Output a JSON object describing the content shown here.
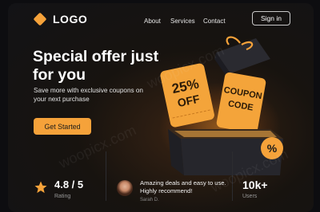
{
  "header": {
    "logo_text": "LOGO",
    "nav": [
      "About",
      "Services",
      "Contact"
    ],
    "signin_label": "Sign in"
  },
  "hero": {
    "title": "Special offer just for you",
    "subtitle": "Save more with exclusive coupons on your next purchase",
    "cta_label": "Get Started"
  },
  "illustration": {
    "discount_percent": "25%",
    "discount_word": "OFF",
    "coupon_line1": "COUPON",
    "coupon_line2": "CODE",
    "badge_symbol": "%"
  },
  "stats": {
    "rating_value": "4.8 / 5",
    "rating_label": "Rating",
    "testimonial_text": "Amazing deals and easy to use. Highly recommend!",
    "testimonial_author": "Sarah D.",
    "users_value": "10k+",
    "users_label": "Users"
  },
  "colors": {
    "accent": "#f5a23a",
    "background": "#131316"
  },
  "watermark": "woopicx.com"
}
